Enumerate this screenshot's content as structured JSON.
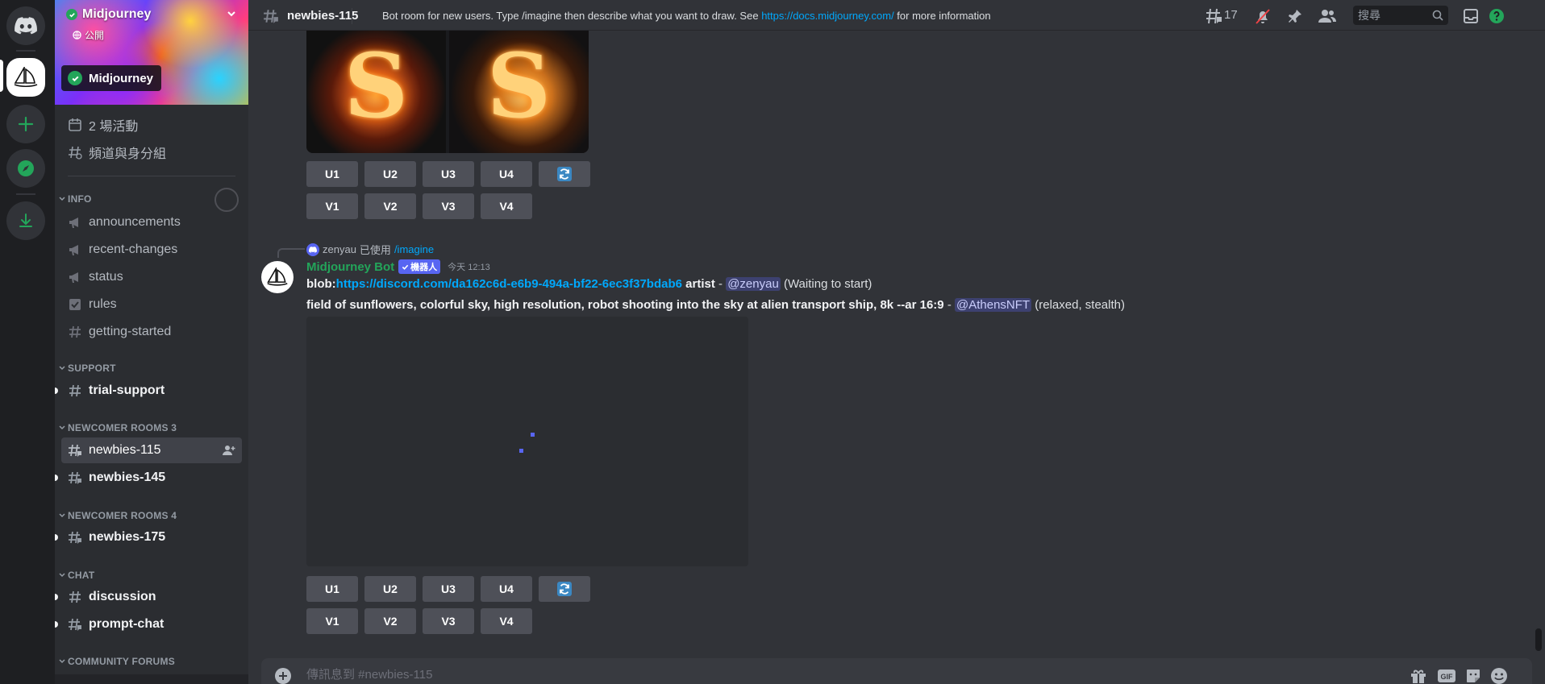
{
  "server": {
    "name": "Midjourney",
    "public_label": "公開",
    "pill_label": "Midjourney",
    "events_label": "2 場活動",
    "channels_roles_label": "頻道與身分組"
  },
  "categories": {
    "info": "INFO",
    "support": "SUPPORT",
    "newcomer3": "NEWCOMER ROOMS 3",
    "newcomer4": "NEWCOMER ROOMS 4",
    "chat": "CHAT",
    "forums": "COMMUNITY FORUMS"
  },
  "channels": {
    "announcements": "announcements",
    "recent_changes": "recent-changes",
    "status": "status",
    "rules": "rules",
    "getting_started": "getting-started",
    "trial_support": "trial-support",
    "newbies_115": "newbies-115",
    "newbies_145": "newbies-145",
    "newbies_175": "newbies-175",
    "discussion": "discussion",
    "prompt_chat": "prompt-chat"
  },
  "header": {
    "channel_name": "newbies-115",
    "topic_before": "Bot room for new users. Type /imagine then describe what you want to draw. See ",
    "topic_link": "https://docs.midjourney.com/",
    "topic_after": " for more information",
    "threads_count": "17",
    "search_placeholder": "搜尋"
  },
  "buttons": {
    "u1": "U1",
    "u2": "U2",
    "u3": "U3",
    "u4": "U4",
    "v1": "V1",
    "v2": "V2",
    "v3": "V3",
    "v4": "V4"
  },
  "top_image_letter": "S",
  "message": {
    "reply_user": "zenyau",
    "reply_used": "已使用",
    "reply_command": "/imagine",
    "author": "Midjourney Bot",
    "bot_tag": "機器人",
    "timestamp": "今天 12:13",
    "line1_prefix": "blob:",
    "line1_link": "https://discord.com/da162c6d-e6b9-494a-bf22-6ec3f37bdab6",
    "line1_bold": " artist",
    "line1_dash": " - ",
    "line1_mention": "@zenyau",
    "line1_status": " (Waiting to start)",
    "line2_prompt": "field of sunflowers, colorful sky, high resolution, robot shooting into the sky at alien transport ship, 8k --ar 16:9",
    "line2_dash": " - ",
    "line2_mention": "@AthensNFT",
    "line2_status": " (relaxed, stealth)"
  },
  "composer": {
    "placeholder": "傳訊息到 #newbies-115"
  },
  "colors": {
    "bot_name": "#23a55a",
    "link": "#00a8fc",
    "blurple": "#5865f2"
  }
}
